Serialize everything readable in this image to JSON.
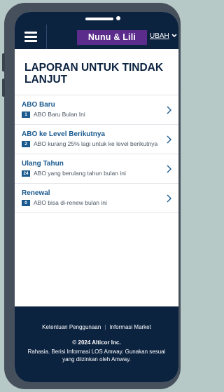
{
  "header": {
    "brand": "Nunu & Lili",
    "change_label": "UBAH"
  },
  "page": {
    "title": "LAPORAN UNTUK TINDAK LANJUT"
  },
  "reports": [
    {
      "title": "ABO Baru",
      "count": "1",
      "description": "ABO Baru Bulan Ini"
    },
    {
      "title": "ABO ke Level Berikutnya",
      "count": "2",
      "description": "ABO kurang 25% lagi untuk ke level berikutnya"
    },
    {
      "title": "Ulang Tahun",
      "count": "24",
      "description": "ABO yang berulang tahun bulan ini"
    },
    {
      "title": "Renewal",
      "count": "0",
      "description": "ABO bisa di-renew bulan ini"
    }
  ],
  "footer": {
    "terms_link": "Ketentuan Penggunaan",
    "separator": "|",
    "market_link": "Informasi Market",
    "copyright": "© 2024 Alticor Inc.",
    "disclaimer": "Rahasia. Berisi Informasi LOS Amway. Gunakan sesuai yang diizinkan oleh Amway."
  },
  "colors": {
    "navy": "#0c2340",
    "brand_purple": "#5b2c8c",
    "link_blue": "#1b5a8e",
    "frame": "#46505c",
    "background": "#b7c9c6"
  },
  "icons": [
    "menu-icon",
    "chevron-down-icon",
    "chevron-right-icon"
  ]
}
